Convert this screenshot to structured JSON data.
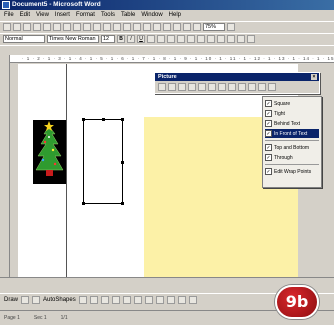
{
  "window": {
    "title": "Document5 - Microsoft Word"
  },
  "menu": [
    "File",
    "Edit",
    "View",
    "Insert",
    "Format",
    "Tools",
    "Table",
    "Window",
    "Help"
  ],
  "formatting": {
    "style": "Normal",
    "font": "Times New Roman",
    "size": "12",
    "zoom": "75%"
  },
  "picture_toolbar": {
    "title": "Picture"
  },
  "wrap_menu": {
    "items": [
      {
        "label": "Square"
      },
      {
        "label": "Tight"
      },
      {
        "label": "Behind Text"
      },
      {
        "label": "In Front of Text",
        "selected": true
      },
      {
        "label": "Top and Bottom"
      },
      {
        "label": "Through"
      },
      {
        "label": "Edit Wrap Points"
      }
    ]
  },
  "drawing": {
    "draw_label": "Draw",
    "autoshapes_label": "AutoShapes"
  },
  "status": {
    "page": "Page 1",
    "sec": "Sec 1",
    "pages": "1/1"
  },
  "badge": {
    "text": "9b"
  },
  "colors": {
    "titlebar": "#0a246a",
    "page_yellow": "#fcf1a7",
    "badge": "#c8181d"
  }
}
